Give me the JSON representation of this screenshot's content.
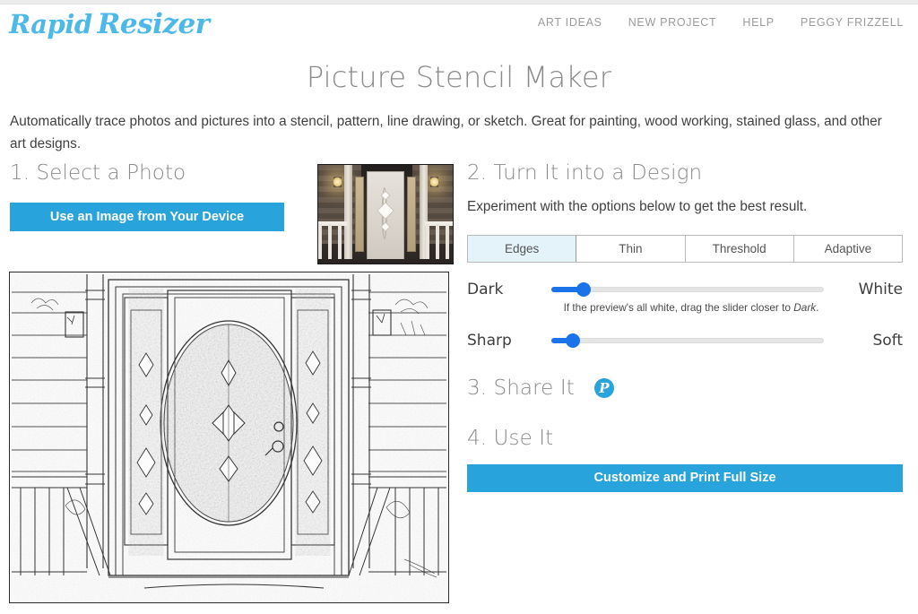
{
  "header": {
    "logo_word1": "Rapid",
    "logo_word2": "Resizer",
    "nav": [
      {
        "label": "ART IDEAS",
        "name": "nav-art-ideas"
      },
      {
        "label": "NEW PROJECT",
        "name": "nav-new-project"
      },
      {
        "label": "HELP",
        "name": "nav-help"
      },
      {
        "label": "PEGGY FRIZZELL",
        "name": "nav-account"
      }
    ]
  },
  "page": {
    "title": "Picture Stencil Maker",
    "intro": "Automatically trace photos and pictures into a stencil, pattern, line drawing, or sketch. Great for painting, wood working, stained glass, and other art designs."
  },
  "step1": {
    "heading": "1. Select a Photo",
    "upload_button": "Use an Image from Your Device",
    "thumbnail_alt": "front-door-photo-thumbnail"
  },
  "step2": {
    "heading": "2. Turn It into a Design",
    "subtext": "Experiment with the options below to get the best result.",
    "tabs": [
      {
        "label": "Edges",
        "active": true
      },
      {
        "label": "Thin",
        "active": false
      },
      {
        "label": "Threshold",
        "active": false
      },
      {
        "label": "Adaptive",
        "active": false
      }
    ],
    "sliders": [
      {
        "name": "darkness-slider",
        "left_label": "Dark",
        "right_label": "White",
        "value_percent": 12,
        "hint_prefix": "If the preview's all white, drag the slider closer to ",
        "hint_emphasis": "Dark",
        "hint_suffix": "."
      },
      {
        "name": "sharpness-slider",
        "left_label": "Sharp",
        "right_label": "Soft",
        "value_percent": 8
      }
    ]
  },
  "step3": {
    "heading": "3. Share It",
    "pinterest_glyph": "P",
    "pinterest_color": "#29a3dc"
  },
  "step4": {
    "heading": "4. Use It",
    "print_button": "Customize and Print Full Size"
  },
  "preview": {
    "alt": "stencil-line-drawing-of-front-door"
  },
  "colors": {
    "brand_blue": "#29a3dc",
    "logo_blue": "#4db9e8",
    "slider_blue": "#1a73e8",
    "tab_active_bg": "#e4f2fa",
    "heading_gray": "#8a8a8a",
    "nav_gray": "#9b9b9b"
  }
}
